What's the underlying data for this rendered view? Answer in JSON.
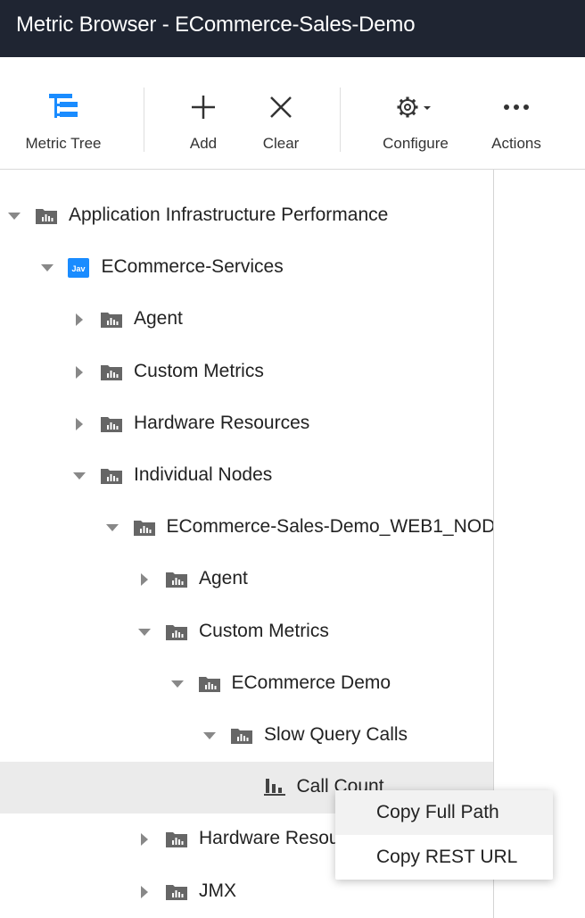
{
  "window": {
    "title": "Metric Browser - ECommerce-Sales-Demo"
  },
  "toolbar": {
    "metric_tree": "Metric Tree",
    "add": "Add",
    "clear": "Clear",
    "configure": "Configure",
    "actions": "Actions",
    "accent_color": "#1a8cff"
  },
  "tree": {
    "nodes": [
      {
        "label": "Application Infrastructure Performance",
        "icon": "folder-chart-icon",
        "state": "expanded"
      },
      {
        "label": "ECommerce-Services",
        "icon": "java-app-icon",
        "icon_text": "Jav",
        "state": "expanded"
      },
      {
        "label": "Agent",
        "icon": "folder-chart-icon",
        "state": "collapsed"
      },
      {
        "label": "Custom Metrics",
        "icon": "folder-chart-icon",
        "state": "collapsed"
      },
      {
        "label": "Hardware Resources",
        "icon": "folder-chart-icon",
        "state": "collapsed"
      },
      {
        "label": "Individual Nodes",
        "icon": "folder-chart-icon",
        "state": "expanded"
      },
      {
        "label": "ECommerce-Sales-Demo_WEB1_NOD",
        "icon": "folder-chart-icon",
        "state": "expanded"
      },
      {
        "label": "Agent",
        "icon": "folder-chart-icon",
        "state": "collapsed"
      },
      {
        "label": "Custom Metrics",
        "icon": "folder-chart-icon",
        "state": "expanded"
      },
      {
        "label": "ECommerce Demo",
        "icon": "folder-chart-icon",
        "state": "expanded"
      },
      {
        "label": "Slow Query Calls",
        "icon": "folder-chart-icon",
        "state": "expanded"
      },
      {
        "label": "Call Count",
        "icon": "bar-chart-icon",
        "state": "leaf",
        "selected": true
      },
      {
        "label": "Hardware Resources",
        "icon": "folder-chart-icon",
        "state": "collapsed"
      },
      {
        "label": "JMX",
        "icon": "folder-chart-icon",
        "state": "collapsed"
      }
    ]
  },
  "context_menu": {
    "items": [
      {
        "label": "Copy Full Path"
      },
      {
        "label": "Copy REST URL"
      }
    ]
  }
}
